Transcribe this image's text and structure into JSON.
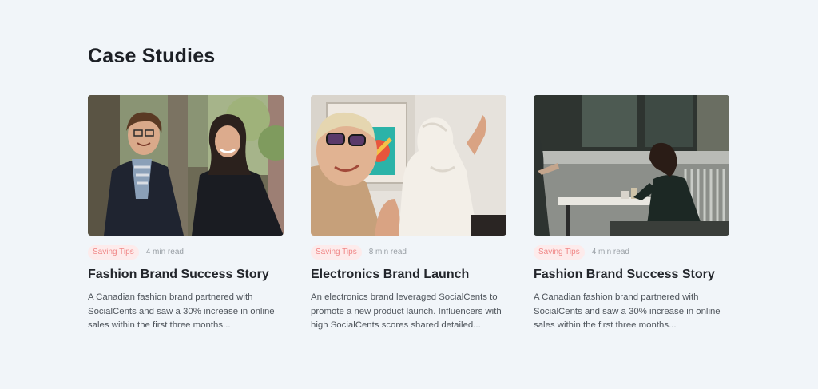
{
  "section": {
    "title": "Case Studies"
  },
  "cards": [
    {
      "tag": "Saving Tips",
      "read_time": "4 min read",
      "title": "Fashion Brand Success Story",
      "description": "A Canadian fashion brand partnered with SocialCents and saw a 30% increase in online sales within the first three months...",
      "image": "two-people-outdoors-photo"
    },
    {
      "tag": "Saving Tips",
      "read_time": "8 min read",
      "title": "Electronics Brand Launch",
      "description": "An electronics brand leveraged SocialCents to promote a new product launch. Influencers with high SocialCents scores shared detailed...",
      "image": "woman-with-sculpture-photo"
    },
    {
      "tag": "Saving Tips",
      "read_time": "4 min read",
      "title": "Fashion Brand Success Story",
      "description": "A Canadian fashion brand partnered with SocialCents and saw a 30% increase in online sales within the first three months...",
      "image": "cafe-table-photo"
    }
  ],
  "colors": {
    "background": "#f1f5f9",
    "tag_background": "#fdebeb",
    "tag_text": "#f08787"
  }
}
